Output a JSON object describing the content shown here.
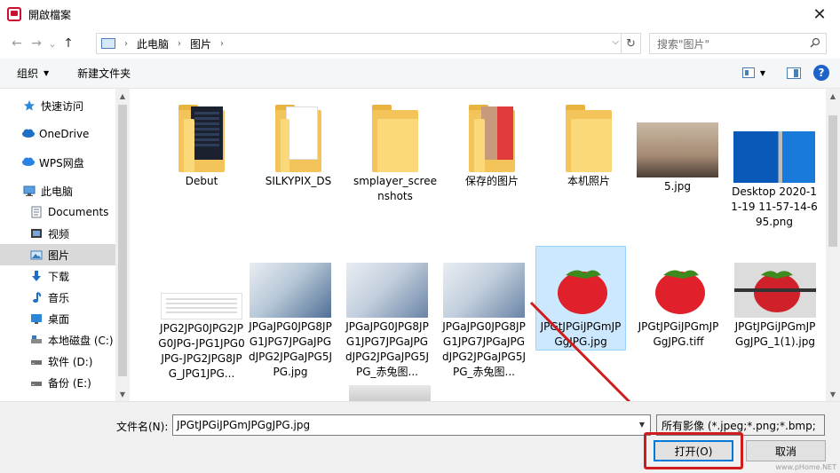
{
  "window": {
    "title": "開啟檔案",
    "close_symbol": "✕"
  },
  "nav": {
    "back_symbol": "←",
    "forward_symbol": "→",
    "history_symbol": "⌄",
    "up_symbol": "↑",
    "breadcrumb": [
      "此电脑",
      "图片"
    ],
    "search_placeholder": "搜索\"图片\""
  },
  "toolbar": {
    "organize_label": "组织",
    "new_folder_label": "新建文件夹"
  },
  "sidebar": {
    "items": [
      {
        "label": "快速访问",
        "icon": "star-icon"
      },
      {
        "label": "OneDrive",
        "icon": "cloud-icon"
      },
      {
        "label": "WPS网盘",
        "icon": "cloud-icon"
      },
      {
        "label": "此电脑",
        "icon": "computer-icon"
      },
      {
        "label": "Documents",
        "icon": "document-icon"
      },
      {
        "label": "视频",
        "icon": "video-icon"
      },
      {
        "label": "图片",
        "icon": "picture-icon"
      },
      {
        "label": "下载",
        "icon": "download-icon"
      },
      {
        "label": "音乐",
        "icon": "music-icon"
      },
      {
        "label": "桌面",
        "icon": "desktop-icon"
      },
      {
        "label": "本地磁盘 (C:)",
        "icon": "drive-icon"
      },
      {
        "label": "软件 (D:)",
        "icon": "drive-icon"
      },
      {
        "label": "备份 (E:)",
        "icon": "drive-icon"
      }
    ],
    "selected_index": 6
  },
  "files": {
    "row1": [
      {
        "label": "Debut",
        "kind": "folder"
      },
      {
        "label": "SILKYPIX_DS",
        "kind": "folder"
      },
      {
        "label": "smplayer_screenshots",
        "kind": "folder"
      },
      {
        "label": "保存的图片",
        "kind": "folder"
      },
      {
        "label": "本机照片",
        "kind": "folder"
      },
      {
        "label": "5.jpg",
        "kind": "image"
      },
      {
        "label": "Desktop 2020-11-19 11-57-14-695.png",
        "kind": "image"
      }
    ],
    "row2": [
      {
        "label": "JPG2JPG0JPG2JPG0JPG-JPG1JPG0JPG-JPG2JPG8JPG_JPG1JPG...",
        "kind": "image"
      },
      {
        "label": "JPGaJPG0JPG8JPG1JPG7JPGaJPGdJPG2JPGaJPG5JPG.jpg",
        "kind": "image"
      },
      {
        "label": "JPGaJPG0JPG8JPG1JPG7JPGaJPGdJPG2JPGaJPG5JPG_赤兔图...",
        "kind": "image"
      },
      {
        "label": "JPGaJPG0JPG8JPG1JPG7JPGaJPGdJPG2JPGaJPG5JPG_赤兔图...",
        "kind": "image"
      },
      {
        "label": "JPGtJPGiJPGmJPGgJPG.jpg",
        "kind": "image"
      },
      {
        "label": "JPGtJPGiJPGmJPGgJPG.tiff",
        "kind": "image"
      },
      {
        "label": "JPGtJPGiJPGmJPGgJPG_1(1).jpg",
        "kind": "image"
      }
    ],
    "selected": "JPGtJPGiJPGmJPGgJPG.jpg"
  },
  "bottom": {
    "filename_label": "文件名(N):",
    "filename_value": "JPGtJPGiJPGmJPGgJPG.jpg",
    "filter_value": "所有影像 (*.jpeg;*.png;*.bmp;",
    "open_label": "打开(O)",
    "cancel_label": "取消"
  },
  "watermark": "www.pHome.NET",
  "colors": {
    "accent": "#0078d7",
    "annotation": "#d01c1c",
    "selection": "#cce8ff"
  }
}
